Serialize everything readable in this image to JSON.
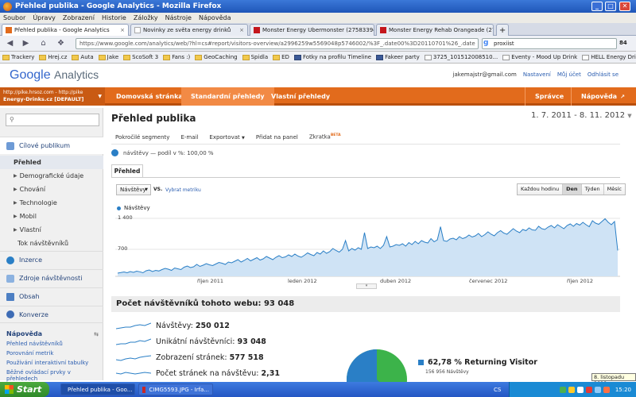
{
  "window": {
    "title": "Přehled publika - Google Analytics - Mozilla Firefox"
  },
  "menu": [
    "Soubor",
    "Úpravy",
    "Zobrazení",
    "Historie",
    "Záložky",
    "Nástroje",
    "Nápověda"
  ],
  "browser_tabs": [
    {
      "label": "Přehled publika - Google Analytics"
    },
    {
      "label": "Novinky ze světa energy drinků"
    },
    {
      "label": "Monster Energy Ubermonster (27583394..."
    },
    {
      "label": "Monster Energy Rehab Orangeade (2758..."
    }
  ],
  "url": "https://www.google.com/analytics/web/?hl=cs#report/visitors-overview/a2996259w5569048p5746002/%3F_.date00%3D20110701%26_.date",
  "search_value": "proxiist",
  "zoom_badge": "84",
  "bookmarks": [
    "Trackery",
    "Hrej.cz",
    "Auta",
    "Jake",
    "ScoSoft 3",
    "Fans :)",
    "GeoCaching",
    "Spidla",
    "ED",
    "Fotky na profilu Timeline",
    "Fakeer party",
    "3725_101512008510...",
    "Eventy - Mood Up Drink",
    "HELL Energy Drink Kaz..."
  ],
  "ga": {
    "logo_google": "Google",
    "logo_analytics": "Analytics",
    "user_email": "jakemajstr@gmail.com",
    "link_settings": "Nastavení",
    "link_account": "Můj účet",
    "link_logout": "Odhlásit se",
    "account_url": "http://pike.hrsoz.com - http://pike",
    "account_name": "Energy-Drinks.cz [DEFAULT]",
    "tabs": [
      "Domovská stránka",
      "Standardní přehledy",
      "Vlastní přehledy"
    ],
    "right_tabs": [
      "Správce",
      "Nápověda"
    ]
  },
  "sidebar": {
    "section": "Cílové publikum",
    "items": [
      "Přehled",
      "Demografické údaje",
      "Chování",
      "Technologie",
      "Mobil",
      "Vlastní",
      "Tok návštěvníků"
    ],
    "mains": [
      "Inzerce",
      "Zdroje návštěvnosti",
      "Obsah",
      "Konverze"
    ],
    "help_title": "Nápověda",
    "help_links": [
      "Přehled návštěvníků",
      "Porovnání metrik",
      "Používání interaktivní tabulky",
      "Běžné ovládací prvky v přehledech"
    ]
  },
  "main": {
    "title": "Přehled publika",
    "date_range": "1. 7. 2011 - 8. 11. 2012",
    "toolbar": [
      "Pokročilé segmenty",
      "E-mail",
      "Exportovat",
      "Přidat na panel",
      "Zkratka"
    ],
    "beta": "BETA",
    "segment": "návštěvy — podíl v %: 100,00 %",
    "tab": "Přehled",
    "metric": "Návštěvy",
    "vs": "VS.",
    "select_metric": "Vybrat metriku",
    "granularity": [
      "Každou hodinu",
      "Den",
      "Týden",
      "Měsíc"
    ],
    "legend": "Návštěvy"
  },
  "chart_data": {
    "type": "area",
    "series": [
      {
        "name": "Návštěvy"
      }
    ],
    "y_ticks": [
      "1 400",
      "700"
    ],
    "ylim": [
      0,
      1600
    ],
    "x_ticks": [
      "říjen 2011",
      "leden 2012",
      "duben 2012",
      "červenec 2012",
      "říjen 2012"
    ],
    "x_range": [
      "2011-07-01",
      "2012-11-08"
    ],
    "values": [
      80,
      95,
      110,
      90,
      120,
      100,
      130,
      115,
      90,
      140,
      160,
      120,
      150,
      135,
      170,
      200,
      180,
      150,
      210,
      190,
      170,
      230,
      260,
      220,
      240,
      300,
      250,
      280,
      320,
      290,
      270,
      310,
      350,
      330,
      300,
      360,
      340,
      380,
      420,
      360,
      400,
      450,
      390,
      430,
      470,
      410,
      440,
      500,
      460,
      420,
      480,
      520,
      470,
      490,
      540,
      500,
      560,
      510,
      480,
      530,
      590,
      550,
      520,
      600,
      560,
      640,
      580,
      620,
      700,
      650,
      610,
      680,
      900,
      640,
      700,
      660,
      720,
      680,
      1100,
      700,
      740,
      720,
      760,
      700,
      780,
      1000,
      740,
      760,
      800,
      780,
      820,
      760,
      850,
      800,
      880,
      820,
      900,
      860,
      840,
      950,
      870,
      920,
      1250,
      900,
      880,
      940,
      960,
      920,
      1000,
      950,
      980,
      1040,
      990,
      1020,
      1080,
      1000,
      1050,
      1120,
      1060,
      1020,
      1100,
      1150,
      1090,
      1060,
      1130,
      1200,
      1140,
      1100,
      1180,
      1150,
      1220,
      1170,
      1160,
      1260,
      1200,
      1180,
      1240,
      1280,
      1220,
      1300,
      1250,
      1200,
      1280,
      1320,
      1260,
      1330,
      1290,
      1360,
      1300,
      1250,
      1400,
      1340,
      1310,
      1380,
      1450,
      1360,
      1300,
      1380,
      650
    ]
  },
  "summary": {
    "title": "Počet návštěvníků tohoto webu: 93 048",
    "stats": [
      {
        "label": "Návštěvy:",
        "value": "250 012"
      },
      {
        "label": "Unikátní návštěvníci:",
        "value": "93 048"
      },
      {
        "label": "Zobrazení stránek:",
        "value": "577 518"
      },
      {
        "label": "Počet stránek na návštěvu:",
        "value": "2,31"
      }
    ],
    "pie_label": "62,78 % Returning Visitor",
    "pie_value": 0.6278,
    "pie_sub": "156 956 Návštěvy"
  },
  "tooltip": "8. listopadu 2012",
  "taskbar": {
    "start": "Start",
    "tasks": [
      "Přehled publika - Goo...",
      "CIMG5593.JPG - Irfa..."
    ],
    "lang": "CS",
    "clock": "15:20"
  },
  "colors": {
    "accent": "#e26b1c",
    "series": "#2a7fc6",
    "pie_other": "#3cb34a"
  }
}
